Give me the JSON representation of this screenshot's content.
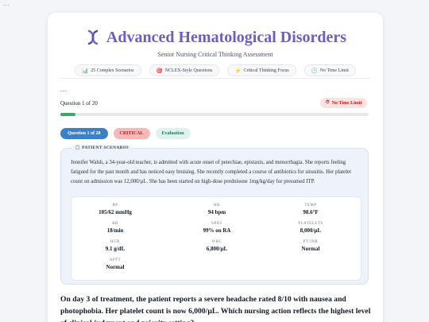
{
  "top_dots": "...",
  "header": {
    "title": "Advanced Hematological Disorders",
    "subtitle": "Senior Nursing Critical Thinking Assessment",
    "pills": [
      {
        "icon": "📊",
        "icon_name": "chart-icon",
        "label": "25 Complex Scenarios"
      },
      {
        "icon": "🎯",
        "icon_name": "target-icon",
        "label": "NCLEX-Style Questions"
      },
      {
        "icon": "⚡",
        "icon_name": "lightning-icon",
        "label": "Critical Thinking Focus"
      },
      {
        "icon": "🕒",
        "icon_name": "clock-icon",
        "label": "No Time Limit"
      }
    ]
  },
  "mid_dots": "...",
  "progress": {
    "question_counter": "Question 1 of 20",
    "timer_icon": "⏱",
    "timer_label": "No Time Limit",
    "fraction": 0.05
  },
  "tags": {
    "question": "Question 1 of 20",
    "severity": "CRITICAL",
    "type": "Evaluation"
  },
  "scenario": {
    "label_icon": "📋",
    "label": "PATIENT SCENARIO",
    "text": "Jennifer Walsh, a 34-year-old teacher, is admitted with acute onset of petechiae, epistaxis, and menorrhagia. She reports feeling fatigued for the past month and has noticed easy bruising. She recently completed a course of antibiotics for sinusitis. Her platelet count on admission was 12,000/µL. She has been started on high-dose prednisone 1mg/kg/day for presumed ITP.",
    "vitals": [
      {
        "label": "BP",
        "value": "105/62 mmHg"
      },
      {
        "label": "HR",
        "value": "94 bpm"
      },
      {
        "label": "TEMP",
        "value": "98.6°F"
      },
      {
        "label": "RR",
        "value": "18/min"
      },
      {
        "label": "SPO2",
        "value": "99% on RA"
      },
      {
        "label": "PLATELETS",
        "value": "8,000/µL"
      },
      {
        "label": "HGB",
        "value": "9.1 g/dL"
      },
      {
        "label": "WBC",
        "value": "6,800/µL"
      },
      {
        "label": "PT/INR",
        "value": "Normal"
      },
      {
        "label": "APTT",
        "value": "Normal"
      }
    ]
  },
  "question": {
    "text": "On day 3 of treatment, the patient reports a severe headache rated 8/10 with nausea and photophobia. Her platelet count is now 6,000/µL. Which nursing action reflects the highest level of clinical judgment and priority setting?"
  },
  "colors": {
    "title": "#6d5fc0",
    "progress_fill": "#3fa66b",
    "question_tag": "#3b82c4",
    "critical_tag": "#f7b8b8",
    "evaluation_tag": "#dff3ee",
    "scenario_bg": "#eef3fb"
  }
}
